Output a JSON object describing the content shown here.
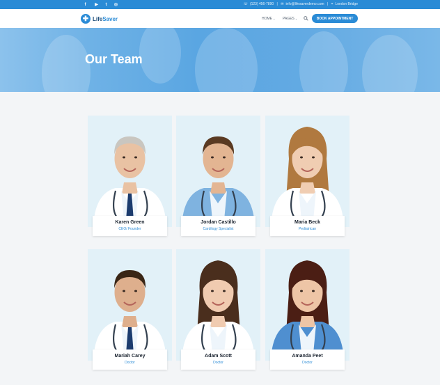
{
  "topbar": {
    "social": [
      {
        "name": "facebook-icon",
        "glyph": "f"
      },
      {
        "name": "youtube-icon",
        "glyph": "▶"
      },
      {
        "name": "twitter-icon",
        "glyph": "t"
      },
      {
        "name": "instagram-icon",
        "glyph": "◎"
      }
    ],
    "phone": "(123) 456-7890",
    "email": "info@lifesaverdemo.com",
    "location": "London Bridge"
  },
  "header": {
    "logo": {
      "prefix": "Life",
      "suffix": "Saver"
    },
    "nav": [
      {
        "label": "HOME"
      },
      {
        "label": "PAGES"
      }
    ],
    "cta": "BOOK APPOINTMENT"
  },
  "hero": {
    "title": "Our Team"
  },
  "team": [
    {
      "name": "Karen Green",
      "role": "CEO/ Founder",
      "skin": "#e9c2a3",
      "hair": "#c9c6c0",
      "scrub": "#ffffff",
      "tie": "#1c3c6e",
      "gender": "m"
    },
    {
      "name": "Jordan Castillo",
      "role": "Cardilogy Specialist",
      "skin": "#e3b592",
      "hair": "#5a3a22",
      "scrub": "#7fb3e0",
      "tie": "",
      "gender": "m"
    },
    {
      "name": "Maria Beck",
      "role": "Pediatrican",
      "skin": "#f0cdb2",
      "hair": "#b0793f",
      "scrub": "#ffffff",
      "tie": "",
      "gender": "f"
    },
    {
      "name": "Mariah Carey",
      "role": "Doctor",
      "skin": "#deaf8d",
      "hair": "#3a2616",
      "scrub": "#ffffff",
      "tie": "#1c3c6e",
      "gender": "m"
    },
    {
      "name": "Adam Scott",
      "role": "Doctor",
      "skin": "#f0cbb0",
      "hair": "#4a2e1d",
      "scrub": "#ffffff",
      "tie": "",
      "gender": "f"
    },
    {
      "name": "Amanda Peet",
      "role": "Doctor",
      "skin": "#eec5a6",
      "hair": "#4b1e14",
      "scrub": "#4f8fd0",
      "tie": "",
      "gender": "f"
    }
  ]
}
